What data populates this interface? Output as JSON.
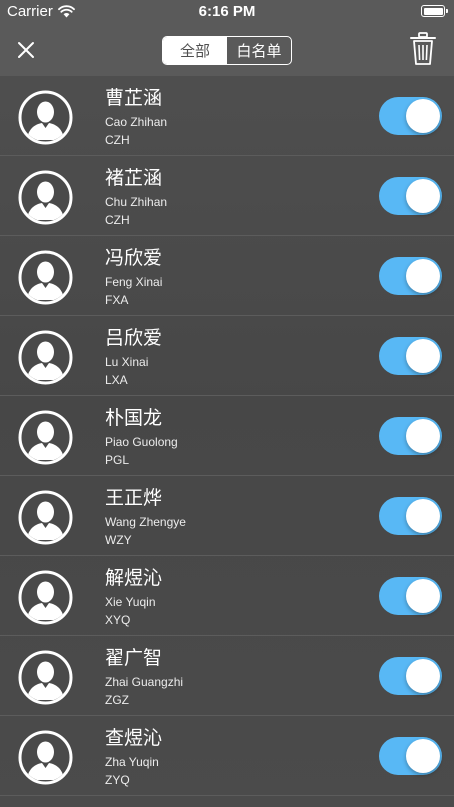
{
  "status_bar": {
    "carrier": "Carrier",
    "time": "6:16 PM",
    "battery_level": 1.0
  },
  "nav_bar": {
    "close_icon": "close-icon",
    "segments": [
      {
        "label": "全部",
        "selected": true
      },
      {
        "label": "白名单",
        "selected": false
      }
    ],
    "trash_icon": "trash-icon"
  },
  "colors": {
    "background": "#4a4a4a",
    "nav_background": "#5a5a5a",
    "toggle_on": "#58b8f5"
  },
  "contacts": [
    {
      "name": "曹芷涵",
      "pinyin": "Cao Zhihan",
      "abbr": "CZH",
      "enabled": true
    },
    {
      "name": "褚芷涵",
      "pinyin": "Chu Zhihan",
      "abbr": "CZH",
      "enabled": true
    },
    {
      "name": "冯欣爱",
      "pinyin": "Feng Xinai",
      "abbr": "FXA",
      "enabled": true
    },
    {
      "name": "吕欣爱",
      "pinyin": "Lu Xinai",
      "abbr": "LXA",
      "enabled": true
    },
    {
      "name": "朴国龙",
      "pinyin": "Piao Guolong",
      "abbr": "PGL",
      "enabled": true
    },
    {
      "name": "王正烨",
      "pinyin": "Wang Zhengye",
      "abbr": "WZY",
      "enabled": true
    },
    {
      "name": "解煜沁",
      "pinyin": "Xie Yuqin",
      "abbr": "XYQ",
      "enabled": true
    },
    {
      "name": "翟广智",
      "pinyin": "Zhai Guangzhi",
      "abbr": "ZGZ",
      "enabled": true
    },
    {
      "name": "查煜沁",
      "pinyin": "Zha Yuqin",
      "abbr": "ZYQ",
      "enabled": true
    }
  ]
}
